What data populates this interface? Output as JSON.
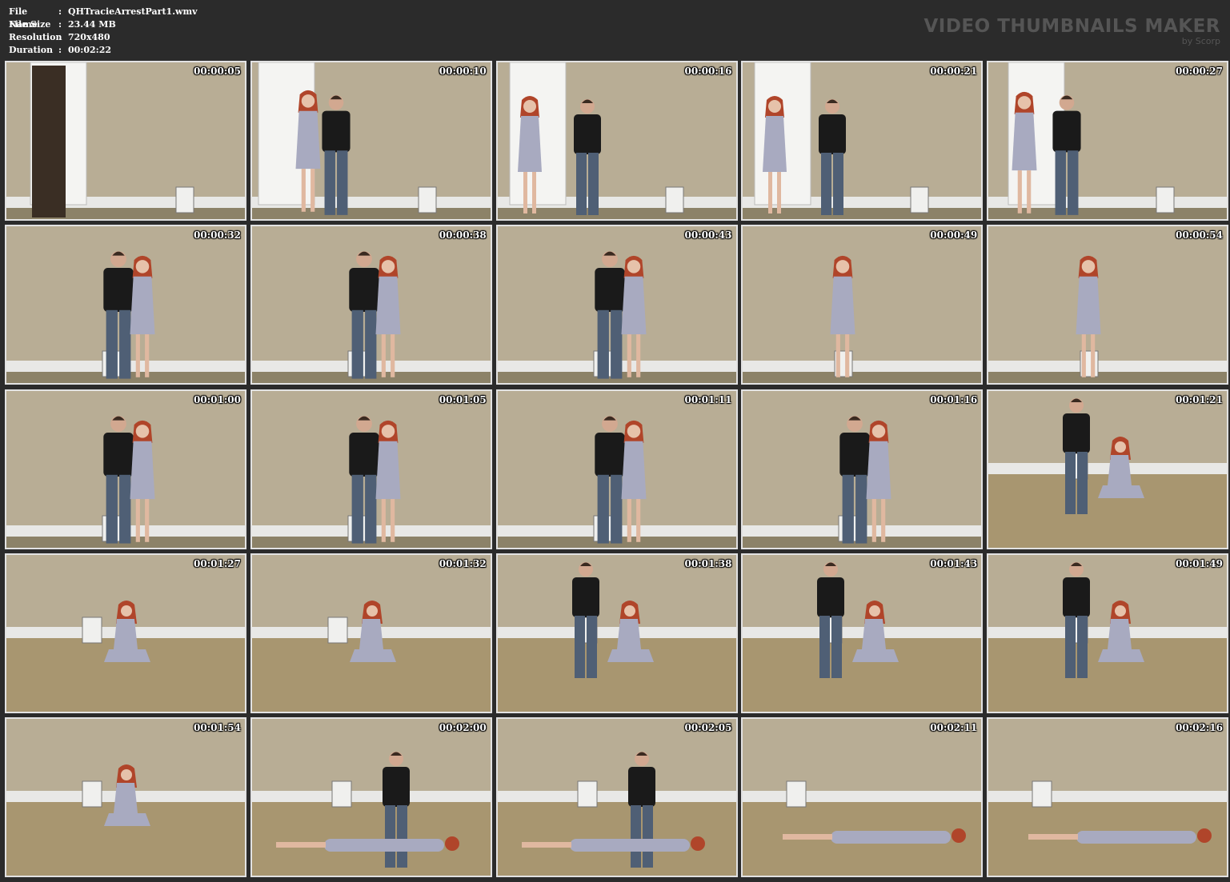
{
  "file_info": {
    "rows": [
      {
        "label": "File Name",
        "sep": ":",
        "value": "QHTracieArrestPart1.wmv"
      },
      {
        "label": "File Size",
        "sep": ":",
        "value": "23.44 MB"
      },
      {
        "label": "Resolution",
        "sep": ":",
        "value": "720x480"
      },
      {
        "label": "Duration",
        "sep": ":",
        "value": "00:02:22"
      }
    ]
  },
  "brand": {
    "title": "VIDEO THUMBNAILS MAKER",
    "subtitle": "by Scorp"
  },
  "thumbnails": [
    {
      "time": "00:00:05",
      "scene": "doorway"
    },
    {
      "time": "00:00:10",
      "scene": "door-two"
    },
    {
      "time": "00:00:16",
      "scene": "door-apart"
    },
    {
      "time": "00:00:21",
      "scene": "door-apart"
    },
    {
      "time": "00:00:27",
      "scene": "door-close"
    },
    {
      "time": "00:00:32",
      "scene": "wall-pair"
    },
    {
      "time": "00:00:38",
      "scene": "wall-pair"
    },
    {
      "time": "00:00:43",
      "scene": "wall-pair"
    },
    {
      "time": "00:00:49",
      "scene": "wall-solo"
    },
    {
      "time": "00:00:54",
      "scene": "wall-solo"
    },
    {
      "time": "00:01:00",
      "scene": "wall-pair"
    },
    {
      "time": "00:01:05",
      "scene": "wall-pair"
    },
    {
      "time": "00:01:11",
      "scene": "wall-pair"
    },
    {
      "time": "00:01:16",
      "scene": "wall-pair"
    },
    {
      "time": "00:01:21",
      "scene": "kneel-pair"
    },
    {
      "time": "00:01:27",
      "scene": "kneel-solo"
    },
    {
      "time": "00:01:32",
      "scene": "kneel-solo"
    },
    {
      "time": "00:01:38",
      "scene": "kneel-pair"
    },
    {
      "time": "00:01:43",
      "scene": "kneel-pair"
    },
    {
      "time": "00:01:49",
      "scene": "kneel-pair"
    },
    {
      "time": "00:01:54",
      "scene": "kneel-solo"
    },
    {
      "time": "00:02:00",
      "scene": "floor-pair"
    },
    {
      "time": "00:02:05",
      "scene": "floor-pair"
    },
    {
      "time": "00:02:11",
      "scene": "floor-solo"
    },
    {
      "time": "00:02:16",
      "scene": "floor-solo"
    }
  ],
  "colors": {
    "background": "#2b2b2b",
    "thumb_border": "#e2e2e2",
    "wall": "#b8ad95",
    "floor": "#a89670",
    "baseboard": "#e8e8e6",
    "dress": "#a8aac0",
    "shirt": "#1a1a1a",
    "jeans": "#4f5f75",
    "hair": "#b0452a"
  }
}
